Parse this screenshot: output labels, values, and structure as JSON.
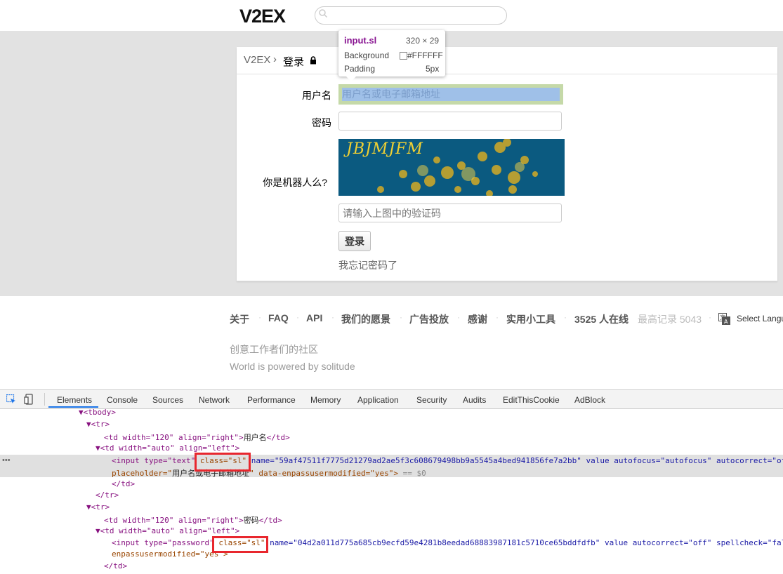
{
  "header": {
    "logo": "V2EX",
    "search_placeholder": ""
  },
  "breadcrumb": {
    "home": "V2EX",
    "separator": "›",
    "current": "登录"
  },
  "form": {
    "username_label": "用户名",
    "username_placeholder": "用户名或电子邮箱地址",
    "password_label": "密码",
    "robot_label": "你是机器人么?",
    "captcha_text": "JBJMJFM",
    "captcha_placeholder": "请输入上图中的验证码",
    "login_button": "登录",
    "forgot_link": "我忘记密码了"
  },
  "tooltip": {
    "element": "input.sl",
    "size": "320 × 29",
    "background_label": "Background",
    "background_value": "#FFFFFF",
    "padding_label": "Padding",
    "padding_value": "5px"
  },
  "footer": {
    "links": [
      "关于",
      "FAQ",
      "API",
      "我们的愿景",
      "广告投放",
      "感谢",
      "实用小工具"
    ],
    "online": "3525 人在线",
    "record": "最高记录 5043",
    "select_language": "Select Langu",
    "tagline": "创意工作者们的社区",
    "powered": "World is powered by solitude"
  },
  "devtools": {
    "tabs": [
      "Elements",
      "Console",
      "Sources",
      "Network",
      "Performance",
      "Memory",
      "Application",
      "Security",
      "Audits",
      "EditThisCookie",
      "AdBlock"
    ],
    "active_tab": "Elements",
    "dots": "•••",
    "lines": {
      "l1": "▼<tbody>",
      "l2": "▼<tr>",
      "l3a": "<td width=\"120\" align=\"right\">",
      "l3b": "用户名",
      "l3c": "</td>",
      "l4": "▼<td width=\"auto\" align=\"left\">",
      "l5a": "<input type=\"text\" ",
      "l5b": "class=\"sl\"",
      "l5c": " name=\"59af47511f7775d21279ad2ae5f3c608679498bb9a5545a4bed941856fe7a2bb\" value autofocus=\"autofocus\" autocorrect=\"of",
      "l6a": "placeholder=\"",
      "l6b": "用户名或电子邮箱地址",
      "l6c": "\" data-enpassusermodified=\"yes\">",
      "l6d": " == $0",
      "l7": "</td>",
      "l8": "</tr>",
      "l9": "▼<tr>",
      "l10a": "<td width=\"120\" align=\"right\">",
      "l10b": "密码",
      "l10c": "</td>",
      "l11": "▼<td width=\"auto\" align=\"left\">",
      "l12a": "<input type=\"password\" ",
      "l12b": "class=\"sl\"",
      "l12c": " name=\"04d2a011d775a685cb9ecfd59e4281b8eedad68883987181c5710ce65bddfdfb\" value autocorrect=\"off\" spellcheck=\"fal",
      "l13": "enpassusermodified=\"yes\">",
      "l14": "</td>"
    }
  }
}
